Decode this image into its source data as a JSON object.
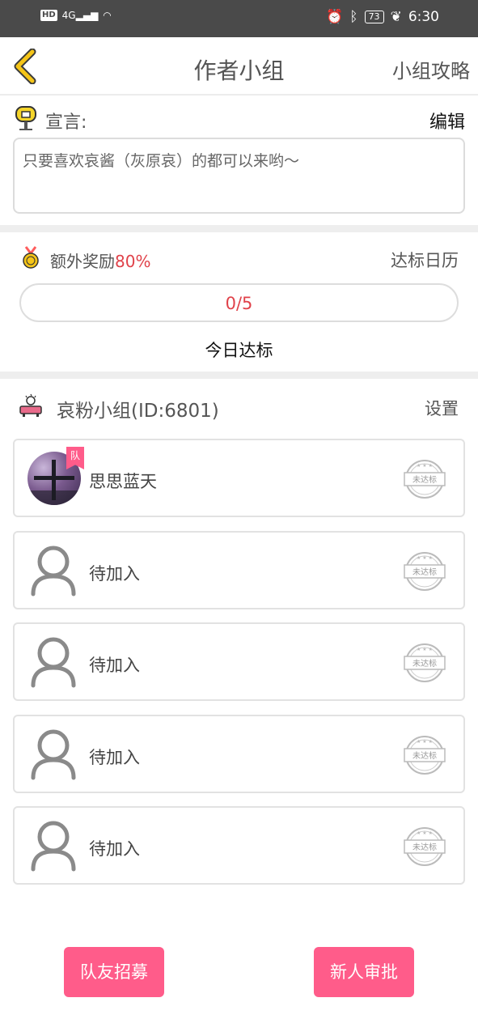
{
  "status_bar": {
    "left_indicators": "HD 4G",
    "battery": "73",
    "time": "6:30"
  },
  "header": {
    "title": "作者小组",
    "right_link": "小组攻略"
  },
  "manifesto": {
    "label": "宣言:",
    "edit_label": "编辑",
    "text": "只要喜欢哀酱（灰原哀）的都可以来哟～"
  },
  "reward": {
    "label": "额外奖励",
    "percent": "80%",
    "calendar_link": "达标日历",
    "progress_text": "0/5",
    "progress_fraction": 0,
    "today_label": "今日达标"
  },
  "group": {
    "title": "哀粉小组(ID:6801)",
    "settings_label": "设置",
    "members": [
      {
        "name": "思思蓝天",
        "has_avatar": true,
        "tag": "队",
        "stamp": "未达标"
      },
      {
        "name": "待加入",
        "has_avatar": false,
        "stamp": "未达标"
      },
      {
        "name": "待加入",
        "has_avatar": false,
        "stamp": "未达标"
      },
      {
        "name": "待加入",
        "has_avatar": false,
        "stamp": "未达标"
      },
      {
        "name": "待加入",
        "has_avatar": false,
        "stamp": "未达标"
      }
    ]
  },
  "actions": {
    "recruit_label": "队友招募",
    "approve_label": "新人审批"
  },
  "colors": {
    "accent_pink": "#ff5c8a",
    "progress_red": "#e0424a",
    "back_arrow": "#f5c518"
  }
}
